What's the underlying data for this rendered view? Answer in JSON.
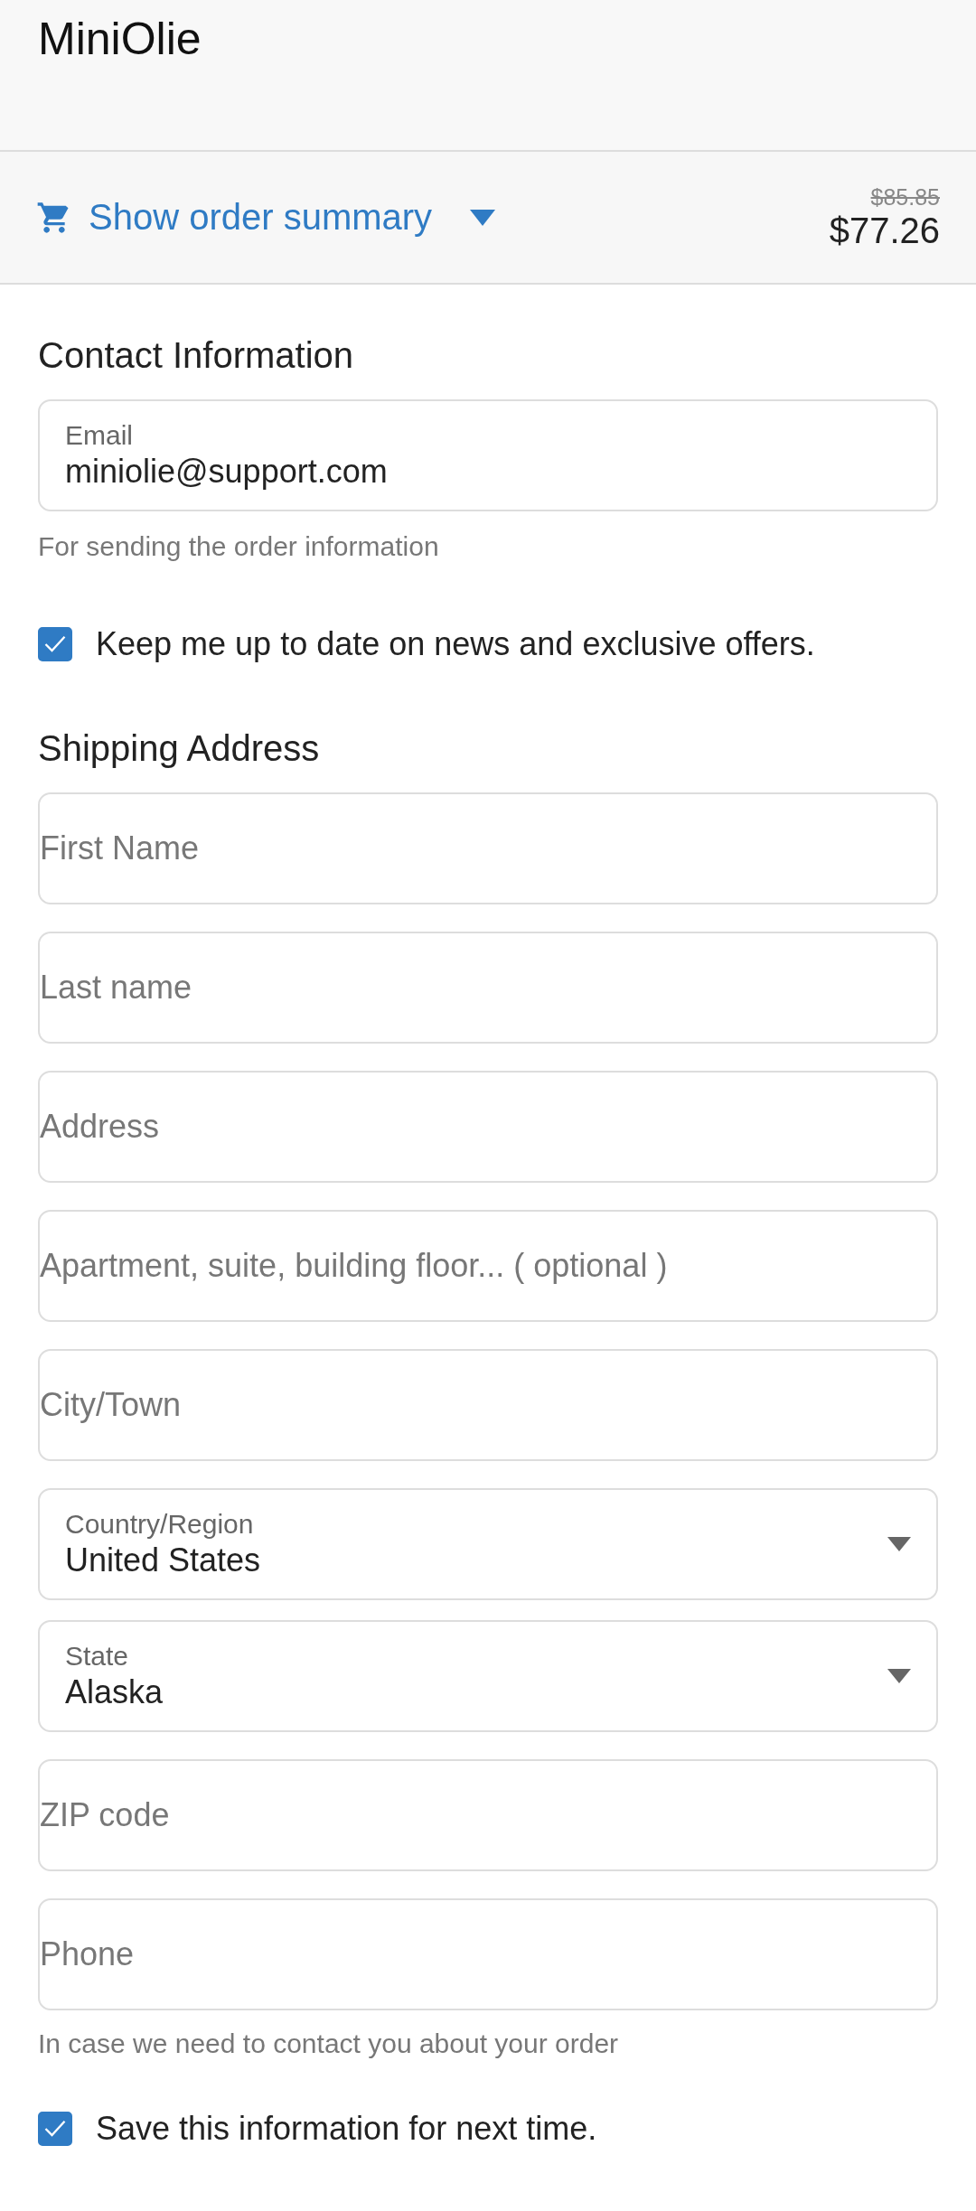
{
  "header": {
    "title": "MiniOlie"
  },
  "order_summary": {
    "label": "Show order summary",
    "expanded": false,
    "original_price": "$85.85",
    "price": "$77.26"
  },
  "contact": {
    "heading": "Contact Information",
    "email": {
      "kind": "labeled",
      "label": "Email",
      "value": "miniolie@support.com"
    },
    "hint": "For sending the order information",
    "newsletter": {
      "label": "Keep me up to date on news and exclusive offers.",
      "checked": true
    }
  },
  "shipping": {
    "heading": "Shipping Address",
    "fields": [
      {
        "kind": "input",
        "placeholder": "First Name"
      },
      {
        "kind": "input",
        "placeholder": "Last name"
      },
      {
        "kind": "input",
        "placeholder": "Address"
      },
      {
        "kind": "input",
        "placeholder": "Apartment, suite, building floor... ( optional )"
      },
      {
        "kind": "input",
        "placeholder": "City/Town"
      },
      {
        "kind": "select",
        "label": "Country/Region",
        "value": "United States"
      },
      {
        "kind": "select",
        "label": "State",
        "value": "Alaska"
      },
      {
        "kind": "input",
        "placeholder": "ZIP code"
      },
      {
        "kind": "input",
        "placeholder": "Phone"
      }
    ],
    "hint": "In case we need to contact you about your order",
    "save": {
      "label": "Save this information for next time.",
      "checked": true
    }
  }
}
